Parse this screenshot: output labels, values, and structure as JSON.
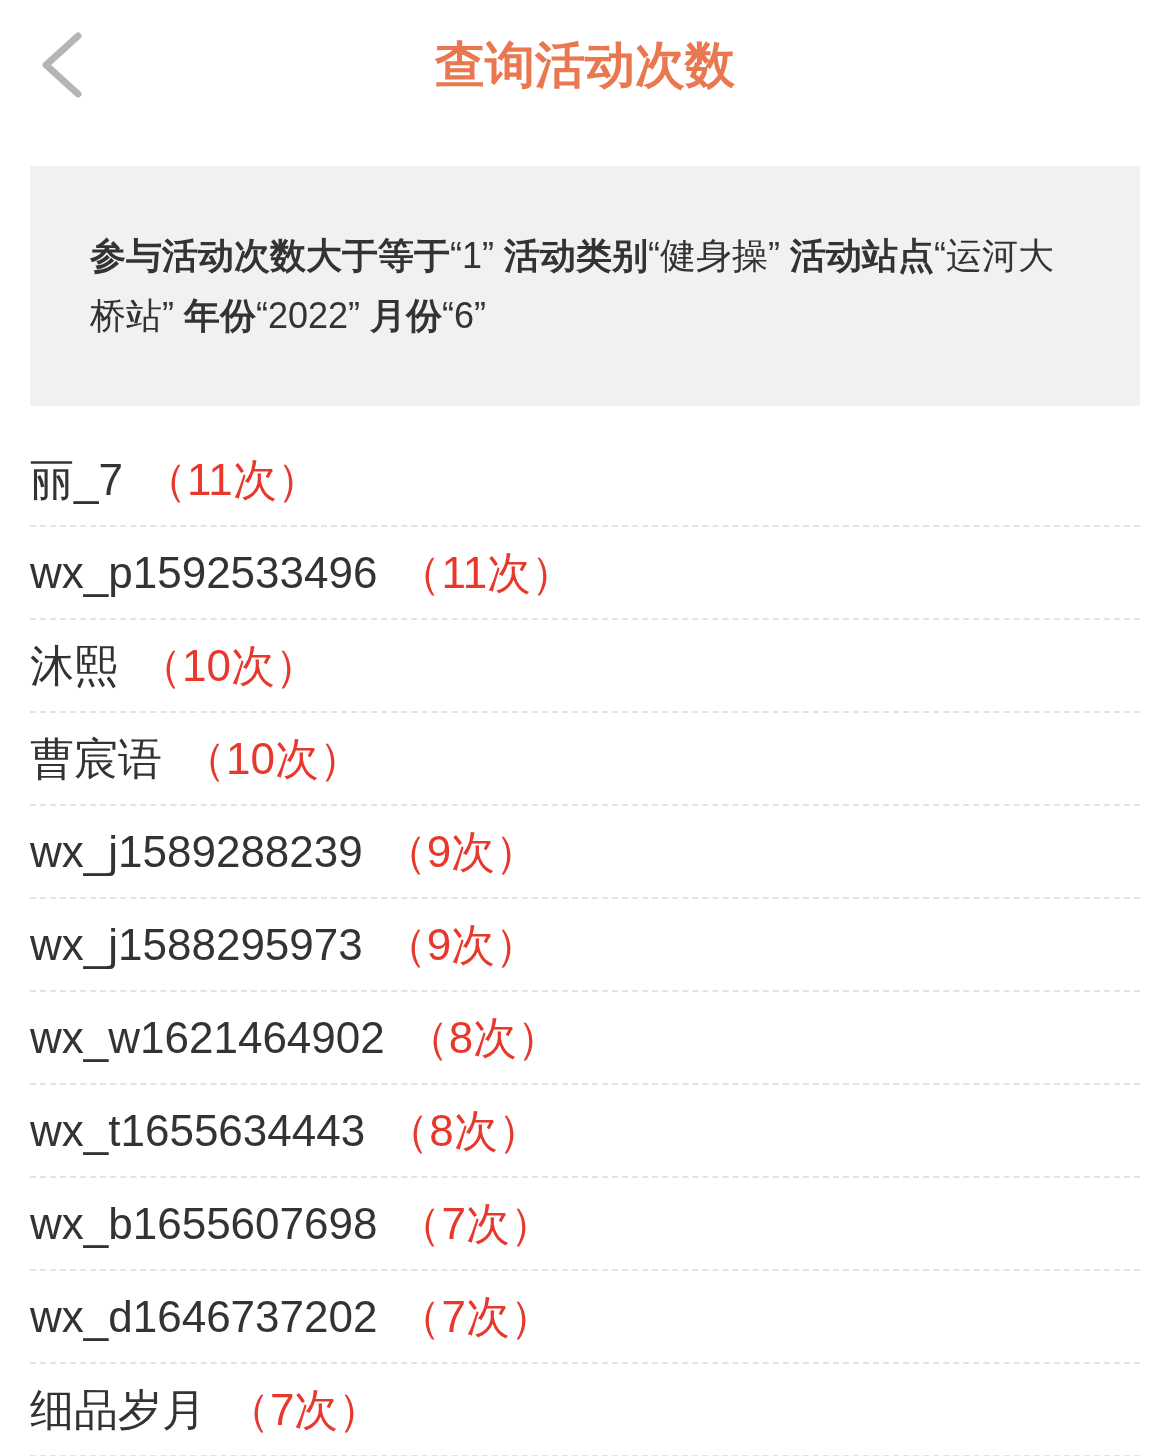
{
  "header": {
    "title": "查询活动次数"
  },
  "filter": {
    "summary": "**参与活动次数大于等于**“1” **活动类别**“健身操” **活动站点**“运河大桥站” **年份**“2022” **月份**“6”"
  },
  "results": [
    {
      "name": "丽_7",
      "count": "（11次）"
    },
    {
      "name": "wx_p1592533496",
      "count": "（11次）"
    },
    {
      "name": "沐熙",
      "count": "（10次）"
    },
    {
      "name": "曹宸语",
      "count": "（10次）"
    },
    {
      "name": "wx_j1589288239",
      "count": "（9次）"
    },
    {
      "name": "wx_j1588295973",
      "count": "（9次）"
    },
    {
      "name": "wx_w1621464902",
      "count": "（8次）"
    },
    {
      "name": "wx_t1655634443",
      "count": "（8次）"
    },
    {
      "name": "wx_b1655607698",
      "count": "（7次）"
    },
    {
      "name": "wx_d1646737202",
      "count": "（7次）"
    },
    {
      "name": "细品岁月",
      "count": "（7次）"
    }
  ]
}
